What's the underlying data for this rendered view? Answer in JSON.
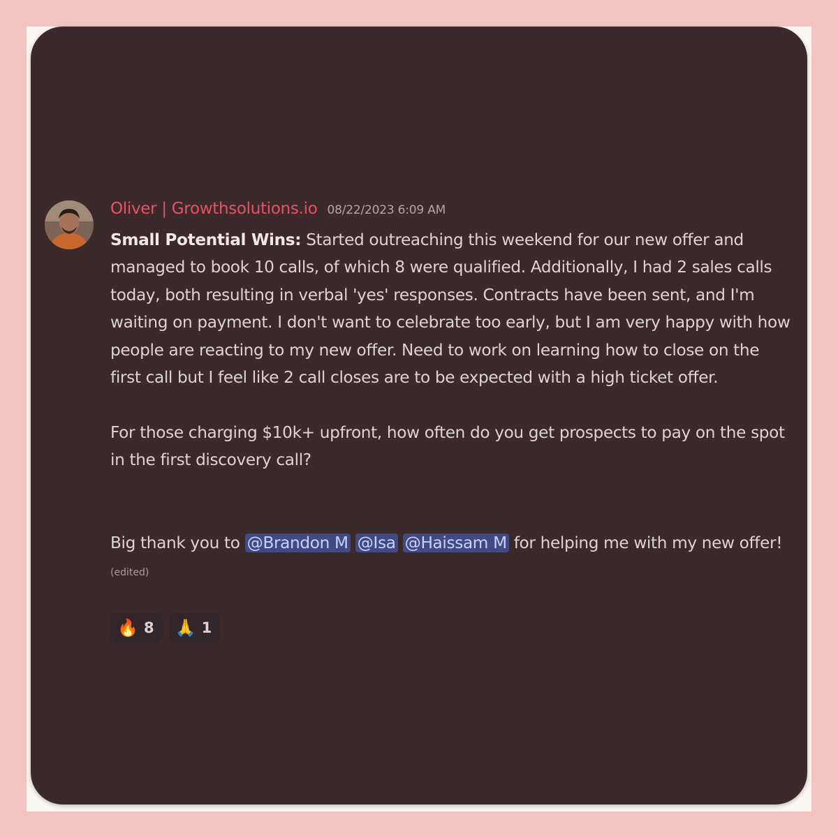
{
  "message": {
    "author": "Oliver | Growthsolutions.io",
    "timestamp": "08/22/2023 6:09 AM",
    "bold_lead": "Small Potential Wins:",
    "paragraph1": " Started outreaching this weekend for our new offer and managed to book 10 calls, of which 8 were qualified. Additionally, I had 2 sales calls today, both resulting in verbal 'yes' responses. Contracts have been sent, and I'm waiting on payment. I don't want to celebrate too early, but I am very happy with how people are reacting to my new offer. Need to work on learning how to close on the first call but I feel like 2 call closes are to be expected with a high ticket offer.",
    "paragraph2": "For those charging $10k+ upfront, how often do you get prospects to pay on the spot in the first discovery call?",
    "thanks_prefix": "Big thank you to ",
    "mentions": [
      "@Brandon M",
      "@Isa",
      "@Haissam M"
    ],
    "thanks_suffix": " for helping me with my new offer!",
    "edited_label": "(edited)"
  },
  "reactions": [
    {
      "icon": "fire-emoji",
      "emoji": "🔥",
      "count": "8"
    },
    {
      "icon": "folded-hands-emoji",
      "emoji": "🙏",
      "count": "1"
    }
  ],
  "colors": {
    "page_background": "#f3c4c1",
    "card_background": "#3c2a2b",
    "username": "#e35266",
    "mention_background": "#424a84",
    "mention_text": "#c9d0ff"
  }
}
